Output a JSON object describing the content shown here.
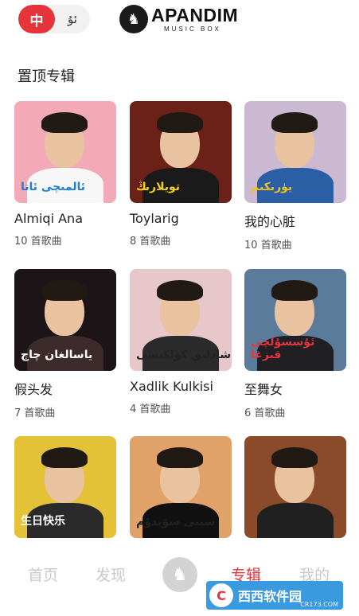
{
  "header": {
    "lang_active": "中",
    "lang_other": "ئۇ",
    "logo_name": "APANDIM",
    "logo_sub": "MUSIC BOX"
  },
  "section": {
    "title": "置顶专辑"
  },
  "albums": [
    {
      "title": "Almiqi Ana",
      "count": "10 首歌曲",
      "cover_bg": "#f4a9b8",
      "body_color": "#f7f7f7",
      "script": "ئالمىچى ئانا",
      "script_color": "#1e7fd6"
    },
    {
      "title": "Toylarig",
      "count": "8 首歌曲",
      "cover_bg": "#6b2018",
      "body_color": "#1a1a1a",
      "script": "تويلارىڭ",
      "script_color": "#f2d21a"
    },
    {
      "title": "我的心脏",
      "count": "10 首歌曲",
      "cover_bg": "#cbb8d2",
      "body_color": "#2a5fa6",
      "script": "يۈرىكىم",
      "script_color": "#f1c21b"
    },
    {
      "title": "假头发",
      "count": "7 首歌曲",
      "cover_bg": "#1c1416",
      "body_color": "#3d2a2a",
      "script": "ياسالغان چاچ",
      "script_color": "#ffffff"
    },
    {
      "title": "Xadlik Kulkisi",
      "count": "4 首歌曲",
      "cover_bg": "#e7c7c9",
      "body_color": "#2b2b2b",
      "script": "شادلىق كۈلكىسى",
      "script_color": "#222222"
    },
    {
      "title": "至舞女",
      "count": "6 首歌曲",
      "cover_bg": "#5a7c9a",
      "body_color": "#1f1f24",
      "script": "ئۇسسۇلچى قىزغا",
      "script_color": "#e5343c"
    },
    {
      "title": "",
      "count": "",
      "cover_bg": "#e3c238",
      "body_color": "#2a2a2a",
      "script": "生日快乐",
      "script_color": "#ffffff"
    },
    {
      "title": "",
      "count": "",
      "cover_bg": "#e1a26a",
      "body_color": "#111111",
      "script": "سېنى سۆيدۇم",
      "script_color": "#222222"
    },
    {
      "title": "",
      "count": "",
      "cover_bg": "#8a4b2a",
      "body_color": "#202020",
      "script": "",
      "script_color": "#ffffff"
    }
  ],
  "nav": {
    "home": "首页",
    "discover": "发现",
    "albums": "专辑",
    "mine": "我的"
  },
  "watermark": {
    "text": "西西软件园",
    "sub": "CR173.COM"
  }
}
